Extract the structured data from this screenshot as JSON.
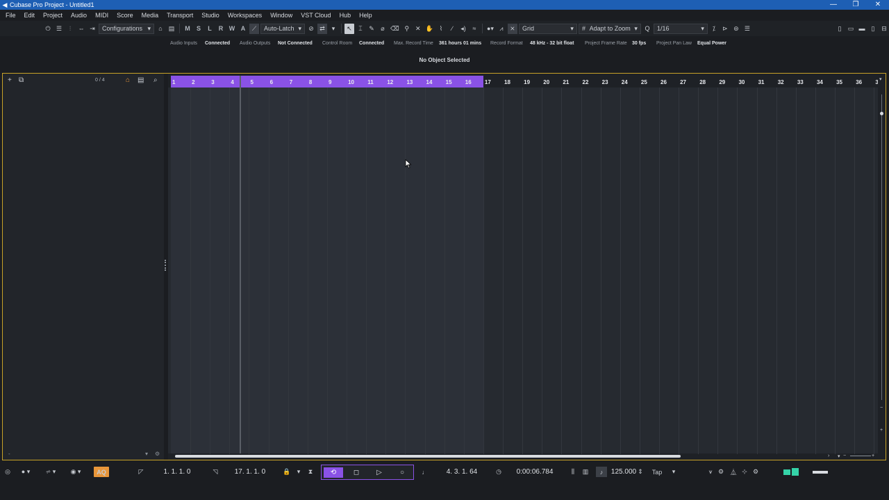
{
  "window": {
    "title": "Cubase Pro Project - Untitled1",
    "controls": [
      "—",
      "❐",
      "✕"
    ]
  },
  "menu": [
    "File",
    "Edit",
    "Project",
    "Audio",
    "MIDI",
    "Score",
    "Media",
    "Transport",
    "Studio",
    "Workspaces",
    "Window",
    "VST Cloud",
    "Hub",
    "Help"
  ],
  "toolbar": {
    "configurations": "Configurations",
    "letters": [
      "M",
      "S",
      "L",
      "R",
      "W",
      "A"
    ],
    "automation_mode": "Auto-Latch",
    "snap_type": "Grid",
    "grid_type": "Adapt to Zoom",
    "quantize": "1/16"
  },
  "status": {
    "audio_inputs_label": "Audio Inputs",
    "audio_inputs_value": "Connected",
    "audio_outputs_label": "Audio Outputs",
    "audio_outputs_value": "Not Connected",
    "control_room_label": "Control Room",
    "control_room_value": "Connected",
    "max_record_label": "Max. Record Time",
    "max_record_value": "361 hours 01 mins",
    "record_format_label": "Record Format",
    "record_format_value": "48 kHz - 32 bit float",
    "frame_rate_label": "Project Frame Rate",
    "frame_rate_value": "30 fps",
    "pan_law_label": "Project Pan Law",
    "pan_law_value": "Equal Power"
  },
  "info_line": "No Object Selected",
  "tracklist": {
    "count": "0 / 4"
  },
  "ruler": {
    "bars": [
      "1",
      "2",
      "3",
      "4",
      "5",
      "6",
      "7",
      "8",
      "9",
      "10",
      "11",
      "12",
      "13",
      "14",
      "15",
      "16",
      "17",
      "18",
      "19",
      "20",
      "21",
      "22",
      "23",
      "24",
      "25",
      "26",
      "27",
      "28",
      "29",
      "30",
      "31",
      "32",
      "33",
      "34",
      "35",
      "36",
      "3"
    ]
  },
  "transport": {
    "left_locator": "1. 1. 1.   0",
    "right_locator": "17. 1. 1.   0",
    "primary_time": "4. 3. 1.  64",
    "secondary_time": "0:00:06.784",
    "tempo": "125.000",
    "tap": "Tap",
    "aq": "AQ"
  },
  "colors": {
    "cycle": "#8a52e6",
    "project_border": "#c9a227",
    "titlebar": "#1e5fb4",
    "aq": "#e8963a"
  }
}
